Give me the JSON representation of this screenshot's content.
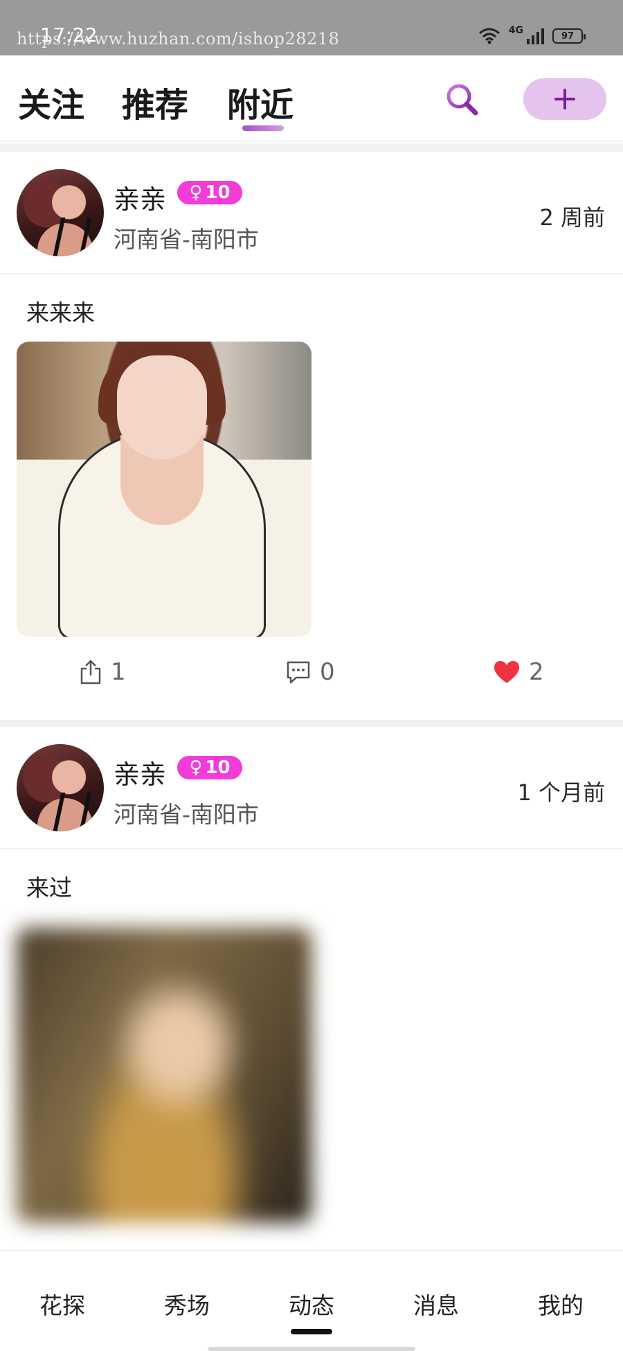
{
  "status_bar": {
    "time": "17:22",
    "watermark": "https://www.huzhan.com/ishop28218",
    "network": "4G",
    "battery": "97"
  },
  "top_tabs": [
    {
      "label": "关注"
    },
    {
      "label": "推荐"
    },
    {
      "label": "附近",
      "active": true
    }
  ],
  "icons": {
    "search": "search-icon",
    "add": "plus-icon",
    "share": "share-icon",
    "comment": "comment-icon",
    "like": "heart-icon"
  },
  "colors": {
    "accent": "#a054c8",
    "add_button_bg": "#e4c3ec",
    "badge": "#f23bd9",
    "heart": "#ee3340"
  },
  "posts": [
    {
      "username": "亲亲",
      "badge_symbol": "♀",
      "badge_level": "10",
      "location": "河南省-南阳市",
      "time": "2 周前",
      "text": "来来来",
      "shares": "1",
      "comments": "0",
      "likes": "2",
      "liked": true
    },
    {
      "username": "亲亲",
      "badge_symbol": "♀",
      "badge_level": "10",
      "location": "河南省-南阳市",
      "time": "1 个月前",
      "text": "来过"
    }
  ],
  "bottom_nav": [
    {
      "label": "花探"
    },
    {
      "label": "秀场"
    },
    {
      "label": "动态",
      "active": true
    },
    {
      "label": "消息"
    },
    {
      "label": "我的"
    }
  ]
}
